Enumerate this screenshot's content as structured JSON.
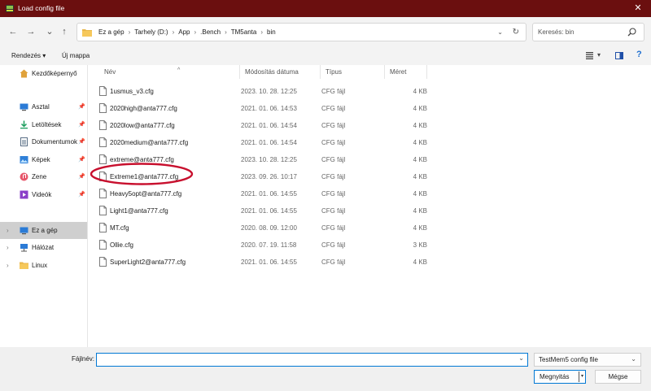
{
  "window": {
    "title": "Load config file",
    "close_glyph": "✕"
  },
  "nav_buttons": {
    "back": "←",
    "forward": "→",
    "up": "↑"
  },
  "address": {
    "crumbs": [
      "Ez a gép",
      "Tarhely (D:)",
      "App",
      ".Bench",
      "TM5anta",
      "bin"
    ],
    "separator": "›",
    "dropdown_glyph": "⌄",
    "refresh_glyph": "↻"
  },
  "search": {
    "placeholder": "Keresés: bin"
  },
  "commandbar": {
    "organize": "Rendezés",
    "organize_arrow": "▾",
    "new_folder": "Új mappa",
    "view_arrow": "▾"
  },
  "sidebar": {
    "items": [
      {
        "label": "Kezdőképernyő",
        "icon": "home-icon",
        "pinned": false,
        "expand": false
      },
      {
        "label": "Asztal",
        "icon": "desktop-icon",
        "pinned": true,
        "expand": false
      },
      {
        "label": "Letöltések",
        "icon": "downloads-icon",
        "pinned": true,
        "expand": false
      },
      {
        "label": "Dokumentumok",
        "icon": "documents-icon",
        "pinned": true,
        "expand": false
      },
      {
        "label": "Képek",
        "icon": "pictures-icon",
        "pinned": true,
        "expand": false
      },
      {
        "label": "Zene",
        "icon": "music-icon",
        "pinned": true,
        "expand": false
      },
      {
        "label": "Videók",
        "icon": "videos-icon",
        "pinned": true,
        "expand": false
      },
      {
        "label": "Ez a gép",
        "icon": "this-pc-icon",
        "pinned": false,
        "expand": true,
        "selected": true
      },
      {
        "label": "Hálózat",
        "icon": "network-icon",
        "pinned": false,
        "expand": true
      },
      {
        "label": "Linux",
        "icon": "linux-folder-icon",
        "pinned": false,
        "expand": true
      }
    ]
  },
  "filelist": {
    "columns": [
      "Név",
      "Módosítás dátuma",
      "Típus",
      "Méret"
    ],
    "sort_caret": "^",
    "files": [
      {
        "name": "1usmus_v3.cfg",
        "date": "2023. 10. 28. 12:25",
        "type": "CFG fájl",
        "size": "4 KB"
      },
      {
        "name": "2020high@anta777.cfg",
        "date": "2021. 01. 06. 14:53",
        "type": "CFG fájl",
        "size": "4 KB"
      },
      {
        "name": "2020low@anta777.cfg",
        "date": "2021. 01. 06. 14:54",
        "type": "CFG fájl",
        "size": "4 KB"
      },
      {
        "name": "2020medium@anta777.cfg",
        "date": "2021. 01. 06. 14:54",
        "type": "CFG fájl",
        "size": "4 KB"
      },
      {
        "name": "extreme@anta777.cfg",
        "date": "2023. 10. 28. 12:25",
        "type": "CFG fájl",
        "size": "4 KB"
      },
      {
        "name": "Extreme1@anta777.cfg",
        "date": "2023. 09. 26. 10:17",
        "type": "CFG fájl",
        "size": "4 KB",
        "circled": true
      },
      {
        "name": "Heavy5opt@anta777.cfg",
        "date": "2021. 01. 06. 14:55",
        "type": "CFG fájl",
        "size": "4 KB"
      },
      {
        "name": "Light1@anta777.cfg",
        "date": "2021. 01. 06. 14:55",
        "type": "CFG fájl",
        "size": "4 KB"
      },
      {
        "name": "MT.cfg",
        "date": "2020. 08. 09. 12:00",
        "type": "CFG fájl",
        "size": "4 KB"
      },
      {
        "name": "Ollie.cfg",
        "date": "2020. 07. 19. 11:58",
        "type": "CFG fájl",
        "size": "3 KB"
      },
      {
        "name": "SuperLight2@anta777.cfg",
        "date": "2021. 01. 06. 14:55",
        "type": "CFG fájl",
        "size": "4 KB"
      }
    ]
  },
  "footer": {
    "filename_label": "Fájlnév:",
    "filename_value": "",
    "filename_dropdown": "⌄",
    "filetype_value": "TestMem5 config file",
    "filetype_dropdown": "⌄",
    "open_label": "Megnyitás",
    "open_split": "▾",
    "cancel_label": "Mégse"
  },
  "colors": {
    "titlebar": "#6b0f0f",
    "annotation": "#c8102e",
    "accent": "#0078d4"
  }
}
